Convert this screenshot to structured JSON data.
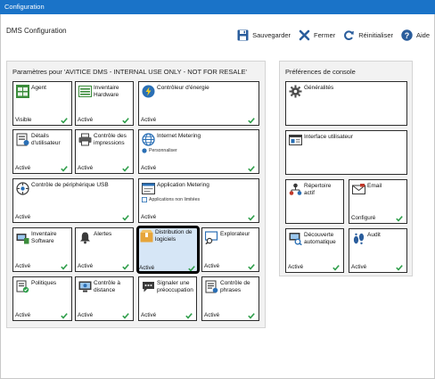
{
  "window": {
    "title": "Configuration"
  },
  "heading": "DMS Configuration",
  "toolbar": {
    "save_label": "Sauvegarder",
    "close_label": "Fermer",
    "reset_label": "Réinitialiser",
    "help_label": "Aide"
  },
  "left_panel": {
    "title": "Paramètres pour 'AVITICE DMS - INTERNAL USE ONLY - NOT FOR RESALE'",
    "tiles": [
      {
        "label": "Agent",
        "status": "Visible",
        "icon": "agent-icon"
      },
      {
        "label": "Inventaire Hardware",
        "status": "Activé",
        "icon": "hardware-inventory-icon"
      },
      {
        "label": "Contrôleur d'énergie",
        "status": "Activé",
        "icon": "energy-icon"
      },
      {
        "label": "Détails d'utilisateur",
        "status": "Activé",
        "icon": "user-details-icon"
      },
      {
        "label": "Contrôle des impressions",
        "status": "Activé",
        "icon": "printer-icon"
      },
      {
        "label": "Internet Metering",
        "sub": "Personnaliser",
        "status": "Activé",
        "icon": "globe-icon"
      },
      {
        "label": "Contrôle de périphérique USB",
        "status": "Activé",
        "icon": "usb-icon"
      },
      {
        "label": "Application Metering",
        "sub": "Applications non limitées",
        "status": "Activé",
        "icon": "application-icon"
      },
      {
        "label": "Inventaire Software",
        "status": "Activé",
        "icon": "software-inventory-icon"
      },
      {
        "label": "Alertes",
        "status": "Activé",
        "icon": "alert-icon"
      },
      {
        "label": "Distribution de logiciels",
        "status": "Activé",
        "icon": "software-distribution-icon"
      },
      {
        "label": "Explorateur",
        "status": "Activé",
        "icon": "explorer-icon"
      },
      {
        "label": "Politiques",
        "status": "Activé",
        "icon": "policy-icon"
      },
      {
        "label": "Contrôle à distance",
        "status": "Activé",
        "icon": "remote-control-icon"
      },
      {
        "label": "Signaler une préoccupation",
        "status": "Activé",
        "icon": "report-concern-icon"
      },
      {
        "label": "Contrôle de phrases",
        "status": "Activé",
        "icon": "phrase-control-icon"
      }
    ]
  },
  "right_panel": {
    "title": "Préférences de console",
    "tiles": [
      {
        "label": "Généralités",
        "status": "",
        "icon": "general-settings-icon"
      },
      {
        "label": "Interface utilisateur",
        "status": "",
        "icon": "user-interface-icon"
      },
      {
        "label": "Répertoire actif",
        "status": "",
        "icon": "active-directory-icon"
      },
      {
        "label": "Email",
        "status": "Configuré",
        "icon": "email-icon"
      },
      {
        "label": "Découverte automatique",
        "status": "Activé",
        "icon": "auto-discovery-icon"
      },
      {
        "label": "Audit",
        "status": "Activé",
        "icon": "audit-icon"
      }
    ]
  },
  "colors": {
    "titlebar": "#1a73c8",
    "selected_tile": "#d6e6f6",
    "check": "#2e9e4a"
  }
}
